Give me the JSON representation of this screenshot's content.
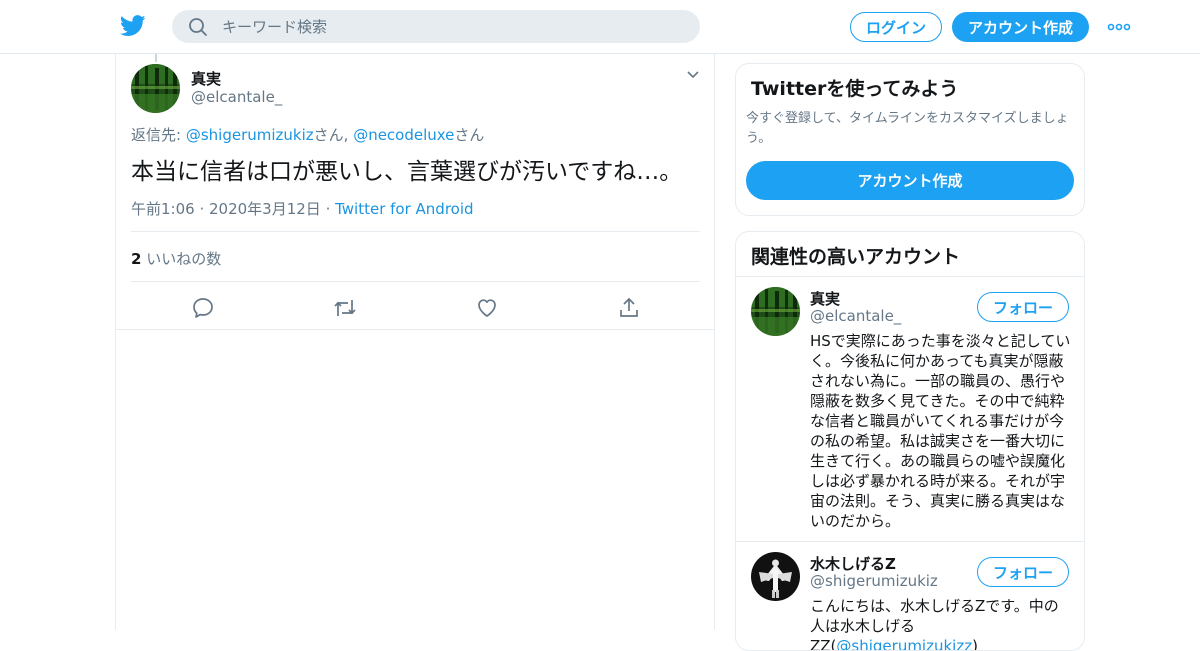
{
  "header": {
    "search_placeholder": "キーワード検索",
    "login_label": "ログイン",
    "signup_label": "アカウント作成",
    "brand_color": "#1da1f2"
  },
  "tweet": {
    "author_name": "真実",
    "author_handle": "@elcantale_",
    "reply_prefix": "返信先: ",
    "reply_user1": "@shigerumizukiz",
    "reply_suffix1": "さん, ",
    "reply_user2": "@necodeluxe",
    "reply_suffix2": "さん",
    "text": "本当に信者は口が悪いし、言葉選びが汚いですね…。",
    "timestamp": "午前1:06 · 2020年3月12日",
    "meta_sep": " · ",
    "source": "Twitter for Android",
    "like_count": "2",
    "like_label": " いいねの数"
  },
  "signup_card": {
    "title": "Twitterを使ってみよう",
    "subtitle": "今すぐ登録して、タイムラインをカスタマイズしましょう。",
    "button": "アカウント作成"
  },
  "recommend": {
    "title": "関連性の高いアカウント",
    "follow_label": "フォロー",
    "accounts": [
      {
        "name": "真実",
        "handle": "@elcantale_",
        "bio": "HSで実際にあった事を淡々と記していく。今後私に何かあっても真実が隠蔽されない為に。一部の職員の、愚行や隠蔽を数多く見てきた。その中で純粋な信者と職員がいてくれる事だけが今の私の希望。私は誠実さを一番大切に生きて行く。あの職員らの嘘や誤魔化しは必ず暴かれる時が来る。それが宇宙の法則。そう、真実に勝る真実はないのだから。"
      },
      {
        "name": "水木しげるZ",
        "handle": "@shigerumizukiz",
        "bio_start": "こんにちは、水木しげるZです。中の人は水木しげるZZ(",
        "bio_link": "@shigerumizukizz",
        "bio_end": ")"
      }
    ]
  }
}
